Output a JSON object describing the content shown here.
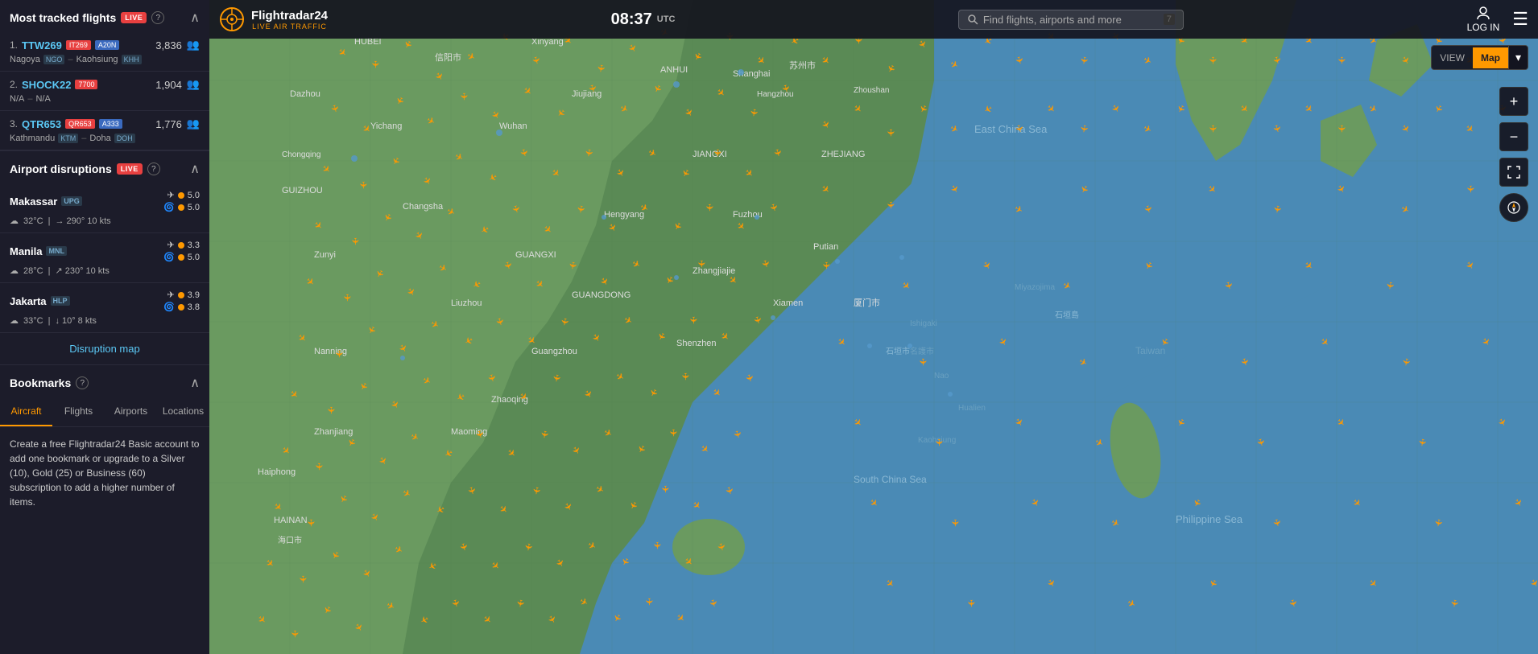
{
  "app": {
    "title": "Flightradar24",
    "subtitle": "LIVE AIR TRAFFIC",
    "time": "08:37",
    "utc_label": "UTC",
    "logo_symbol": "⊙"
  },
  "header": {
    "search_placeholder": "Find flights, airports and more",
    "search_shortcut": "7",
    "login_label": "LOG IN",
    "menu_icon": "☰",
    "view_label": "VIEW",
    "view_active": "Map",
    "view_dropdown": "▾"
  },
  "most_tracked": {
    "title": "Most tracked flights",
    "live_badge": "LIVE",
    "flights": [
      {
        "rank": "1.",
        "flight_id": "TTW269",
        "badge1": "IT269",
        "badge2": "A20N",
        "count": "3,836",
        "from_city": "Nagoya",
        "from_code": "NGO",
        "to_city": "Kaohsiung",
        "to_code": "KHH"
      },
      {
        "rank": "2.",
        "flight_id": "SHOCK22",
        "badge1": "7700",
        "badge2": "",
        "count": "1,904",
        "from_city": "N/A",
        "from_code": "",
        "to_city": "N/A",
        "to_code": ""
      },
      {
        "rank": "3.",
        "flight_id": "QTR653",
        "badge1": "QR653",
        "badge2": "A333",
        "count": "1,776",
        "from_city": "Kathmandu",
        "from_code": "KTM",
        "to_city": "Doha",
        "to_code": "DOH"
      }
    ]
  },
  "airport_disruptions": {
    "title": "Airport disruptions",
    "live_badge": "LIVE",
    "airports": [
      {
        "name": "Makassar",
        "code": "UPG",
        "score1": "5.0",
        "score2": "5.0",
        "temp": "32°C",
        "wind_dir": "290°",
        "wind_speed": "10 kts",
        "wind_icon": "→"
      },
      {
        "name": "Manila",
        "code": "MNL",
        "score1": "3.3",
        "score2": "5.0",
        "temp": "28°C",
        "wind_dir": "230°",
        "wind_speed": "10 kts",
        "wind_icon": "↗"
      },
      {
        "name": "Jakarta",
        "code": "HLP",
        "score1": "3.9",
        "score2": "3.8",
        "temp": "33°C",
        "wind_dir": "10°",
        "wind_speed": "8 kts",
        "wind_icon": "↓"
      }
    ],
    "disruption_link": "Disruption map"
  },
  "bookmarks": {
    "title": "Bookmarks",
    "tabs": [
      "Aircraft",
      "Flights",
      "Airports",
      "Locations"
    ],
    "active_tab": "Aircraft",
    "promo_text": "Create a free Flightradar24 Basic account to add one bookmark or upgrade to a Silver (10), Gold (25) or Business (60) subscription to add a higher number of items."
  },
  "map_controls": {
    "zoom_in": "+",
    "zoom_out": "−",
    "fullscreen": "⛶",
    "compass": "➤"
  }
}
